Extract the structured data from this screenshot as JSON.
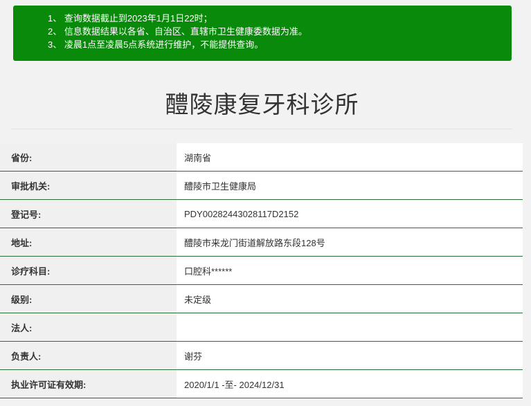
{
  "notice": {
    "lines": [
      "1、 查询数据截止到2023年1月1日22时；",
      "2、 信息数据结果以各省、自治区、直辖市卫生健康委数据为准。",
      "3、 凌晨1点至凌晨5点系统进行维护，不能提供查询。"
    ],
    "background_color": "#0a8a0a"
  },
  "title": "醴陵康复牙科诊所",
  "rows": [
    {
      "label": "省份:",
      "value": "湖南省"
    },
    {
      "label": "审批机关:",
      "value": "醴陵市卫生健康局"
    },
    {
      "label": "登记号:",
      "value": "PDY00282443028117D2152"
    },
    {
      "label": "地址:",
      "value": "醴陵市来龙门街道解放路东段128号"
    },
    {
      "label": "诊疗科目:",
      "value": "口腔科******"
    },
    {
      "label": "级别:",
      "value": "未定级"
    },
    {
      "label": "法人:",
      "value": ""
    },
    {
      "label": "负责人:",
      "value": "谢芬"
    },
    {
      "label": "执业许可证有效期:",
      "value": "2020/1/1 -至- 2024/12/31"
    }
  ]
}
